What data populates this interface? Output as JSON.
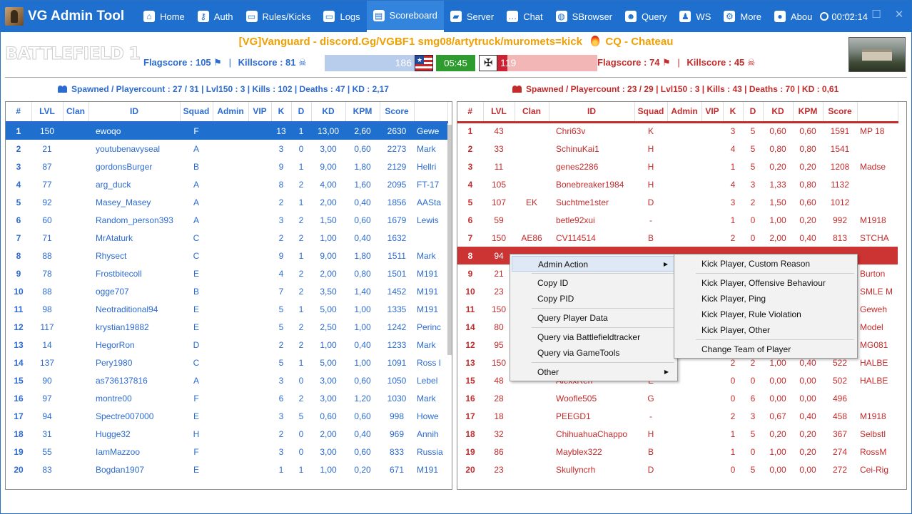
{
  "app": {
    "title": "VG Admin Tool"
  },
  "nav": [
    {
      "label": "Home",
      "icon": "home-icon",
      "glyph": "⌂"
    },
    {
      "label": "Auth",
      "icon": "key-icon",
      "glyph": "⚷"
    },
    {
      "label": "Rules/Kicks",
      "icon": "monitor-icon",
      "glyph": "▭"
    },
    {
      "label": "Logs",
      "icon": "monitor-icon",
      "glyph": "▭"
    },
    {
      "label": "Scoreboard",
      "icon": "scoreboard-icon",
      "glyph": "▤"
    },
    {
      "label": "Server",
      "icon": "folder-icon",
      "glyph": "▰"
    },
    {
      "label": "Chat",
      "icon": "chat-icon",
      "glyph": "…"
    },
    {
      "label": "SBrowser",
      "icon": "globe-icon",
      "glyph": "◍"
    },
    {
      "label": "Query",
      "icon": "user-icon",
      "glyph": "☻"
    },
    {
      "label": "WS",
      "icon": "penguin-icon",
      "glyph": "♟"
    },
    {
      "label": "More",
      "icon": "gear-icon",
      "glyph": "⚙"
    },
    {
      "label": "Abou",
      "icon": "pin-icon",
      "glyph": "●"
    }
  ],
  "active_tab": "Scoreboard",
  "timer": "00:02:14",
  "window_controls": {
    "minimize": "—",
    "maximize": "☐",
    "close": "✕"
  },
  "header": {
    "game_logo": "BATTLEFIELD 1",
    "server_name": "[VG]Vanguard - discord.Gg/VGBF1 smg08/artytruck/muromets=kick",
    "mode_map": "CQ - Chateau",
    "left_flagscore": "Flagscore : 105",
    "left_killscore": "Killscore : 81",
    "right_flagscore": "Flagscore : 74",
    "right_killscore": "Killscore : 45",
    "left_tickets": "186",
    "right_tickets": "119",
    "right_ticket_fill": 0.1,
    "round_time": "05:45",
    "colors": {
      "team1": "#2c6bd1",
      "team2": "#c42b2b",
      "accent": "#1e6fce",
      "timer_bg": "#2e9b2e",
      "title_orange": "#f2a000"
    }
  },
  "team1": {
    "stats": "Spawned / Playercount : 27 / 31  |  Lvl150 : 3  |  Kills : 102  |  Deaths : 47 | KD : 2,17",
    "columns": [
      "#",
      "LVL",
      "Clan",
      "ID",
      "Squad",
      "Admin",
      "VIP",
      "K",
      "D",
      "KD",
      "KPM",
      "Score",
      ""
    ],
    "rows": [
      [
        "1",
        "150",
        "",
        "ewoqo",
        "F",
        "",
        "",
        "13",
        "1",
        "13,00",
        "2,60",
        "2630",
        "Gewe"
      ],
      [
        "2",
        "21",
        "",
        "youtubenavyseal",
        "A",
        "",
        "",
        "3",
        "0",
        "3,00",
        "0,60",
        "2273",
        "Mark"
      ],
      [
        "3",
        "87",
        "",
        "gordonsBurger",
        "B",
        "",
        "",
        "9",
        "1",
        "9,00",
        "1,80",
        "2129",
        "Hellri"
      ],
      [
        "4",
        "77",
        "",
        "arg_duck",
        "A",
        "",
        "",
        "8",
        "2",
        "4,00",
        "1,60",
        "2095",
        "FT-17"
      ],
      [
        "5",
        "92",
        "",
        "Masey_Masey",
        "A",
        "",
        "",
        "2",
        "1",
        "2,00",
        "0,40",
        "1856",
        "AASta"
      ],
      [
        "6",
        "60",
        "",
        "Random_person393",
        "A",
        "",
        "",
        "3",
        "2",
        "1,50",
        "0,60",
        "1679",
        "Lewis"
      ],
      [
        "7",
        "71",
        "",
        "MrAtaturk",
        "C",
        "",
        "",
        "2",
        "2",
        "1,00",
        "0,40",
        "1632",
        ""
      ],
      [
        "8",
        "88",
        "",
        "Rhysect",
        "C",
        "",
        "",
        "9",
        "1",
        "9,00",
        "1,80",
        "1511",
        "Mark"
      ],
      [
        "9",
        "78",
        "",
        "Frostbitecoll",
        "E",
        "",
        "",
        "4",
        "2",
        "2,00",
        "0,80",
        "1501",
        "M191"
      ],
      [
        "10",
        "88",
        "",
        "ogge707",
        "B",
        "",
        "",
        "7",
        "2",
        "3,50",
        "1,40",
        "1452",
        "M191"
      ],
      [
        "11",
        "98",
        "",
        "Neotraditional94",
        "E",
        "",
        "",
        "5",
        "1",
        "5,00",
        "1,00",
        "1335",
        "M191"
      ],
      [
        "12",
        "117",
        "",
        "krystian19882",
        "E",
        "",
        "",
        "5",
        "2",
        "2,50",
        "1,00",
        "1242",
        "Perinc"
      ],
      [
        "13",
        "14",
        "",
        "HegorRon",
        "D",
        "",
        "",
        "2",
        "2",
        "1,00",
        "0,40",
        "1233",
        "Mark"
      ],
      [
        "14",
        "137",
        "",
        "Pery1980",
        "C",
        "",
        "",
        "5",
        "1",
        "5,00",
        "1,00",
        "1091",
        "Ross I"
      ],
      [
        "15",
        "90",
        "",
        "as736137816",
        "A",
        "",
        "",
        "3",
        "0",
        "3,00",
        "0,60",
        "1050",
        "Lebel"
      ],
      [
        "16",
        "97",
        "",
        "montre00",
        "F",
        "",
        "",
        "6",
        "2",
        "3,00",
        "1,20",
        "1030",
        "Mark"
      ],
      [
        "17",
        "94",
        "",
        "Spectre007000",
        "E",
        "",
        "",
        "3",
        "5",
        "0,60",
        "0,60",
        "998",
        "Howe"
      ],
      [
        "18",
        "31",
        "",
        "Hugge32",
        "H",
        "",
        "",
        "2",
        "0",
        "2,00",
        "0,40",
        "969",
        "Annih"
      ],
      [
        "19",
        "55",
        "",
        "IamMazzoo",
        "F",
        "",
        "",
        "3",
        "0",
        "3,00",
        "0,60",
        "833",
        "Russia"
      ],
      [
        "20",
        "83",
        "",
        "Bogdan1907",
        "E",
        "",
        "",
        "1",
        "1",
        "1,00",
        "0,20",
        "671",
        "M191"
      ]
    ]
  },
  "team2": {
    "stats": "Spawned / Playercount : 23 / 29  |  Lvl150 : 3  |  Kills : 43  |  Deaths : 70 | KD : 0,61",
    "columns": [
      "#",
      "LVL",
      "Clan",
      "ID",
      "Squad",
      "Admin",
      "VIP",
      "K",
      "D",
      "KD",
      "KPM",
      "Score",
      ""
    ],
    "rows": [
      [
        "1",
        "43",
        "",
        "Chri63v",
        "K",
        "",
        "",
        "3",
        "5",
        "0,60",
        "0,60",
        "1591",
        "MP 18"
      ],
      [
        "2",
        "33",
        "",
        "SchinuKai1",
        "H",
        "",
        "",
        "4",
        "5",
        "0,80",
        "0,80",
        "1541",
        ""
      ],
      [
        "3",
        "11",
        "",
        "genes2286",
        "H",
        "",
        "",
        "1",
        "5",
        "0,20",
        "0,20",
        "1208",
        "Madse"
      ],
      [
        "4",
        "105",
        "",
        "Bonebreaker1984",
        "H",
        "",
        "",
        "4",
        "3",
        "1,33",
        "0,80",
        "1132",
        ""
      ],
      [
        "5",
        "107",
        "EK",
        "Suchtme1ster",
        "D",
        "",
        "",
        "3",
        "2",
        "1,50",
        "0,60",
        "1012",
        ""
      ],
      [
        "6",
        "59",
        "",
        "betle92xui",
        "-",
        "",
        "",
        "1",
        "0",
        "1,00",
        "0,20",
        "992",
        "M1918"
      ],
      [
        "7",
        "150",
        "AE86",
        "CV114514",
        "B",
        "",
        "",
        "2",
        "0",
        "2,00",
        "0,40",
        "813",
        "STCHA"
      ],
      [
        "8",
        "94",
        "",
        "",
        "",
        "",
        "",
        "",
        "",
        "",
        "",
        "",
        ""
      ],
      [
        "9",
        "21",
        "",
        "",
        "",
        "",
        "",
        "",
        "",
        "",
        "",
        "",
        "Burton"
      ],
      [
        "10",
        "23",
        "",
        "",
        "",
        "",
        "",
        "",
        "",
        "",
        "",
        "",
        "SMLE M"
      ],
      [
        "11",
        "150",
        "",
        "",
        "",
        "",
        "",
        "",
        "",
        "",
        "",
        "",
        "Geweh"
      ],
      [
        "14",
        "80",
        "",
        "",
        "",
        "",
        "",
        "",
        "",
        "",
        "",
        "",
        "Model"
      ],
      [
        "12",
        "95",
        "",
        "",
        "",
        "",
        "",
        "",
        "",
        "",
        "",
        "",
        "MG081"
      ],
      [
        "13",
        "150",
        "",
        "",
        "",
        "",
        "",
        "2",
        "2",
        "1,00",
        "0,40",
        "522",
        "HALBE"
      ],
      [
        "15",
        "48",
        "",
        "AlexxRen",
        "E",
        "",
        "",
        "0",
        "0",
        "0,00",
        "0,00",
        "502",
        "HALBE"
      ],
      [
        "16",
        "28",
        "",
        "Woofle505",
        "G",
        "",
        "",
        "0",
        "6",
        "0,00",
        "0,00",
        "496",
        ""
      ],
      [
        "17",
        "18",
        "",
        "PEEGD1",
        "-",
        "",
        "",
        "2",
        "3",
        "0,67",
        "0,40",
        "458",
        "M1918"
      ],
      [
        "18",
        "32",
        "",
        "ChihuahuaChappo",
        "H",
        "",
        "",
        "1",
        "5",
        "0,20",
        "0,20",
        "367",
        "Selbstl"
      ],
      [
        "19",
        "86",
        "",
        "Mayblex322",
        "B",
        "",
        "",
        "1",
        "0",
        "1,00",
        "0,20",
        "274",
        "RossM"
      ],
      [
        "20",
        "23",
        "",
        "Skullyncrh",
        "D",
        "",
        "",
        "0",
        "5",
        "0,00",
        "0,00",
        "272",
        "Cei-Rig"
      ]
    ]
  },
  "context_menu": {
    "items": [
      "Admin Action",
      "Copy ID",
      "Copy PID",
      "Query Player Data",
      "Query via Battlefieldtracker",
      "Query via GameTools",
      "Other"
    ],
    "submenu": [
      "Kick Player, Custom Reason",
      "Kick Player, Offensive Behaviour",
      "Kick Player, Ping",
      "Kick Player, Rule Violation",
      "Kick Player, Other",
      "Change Team of Player"
    ]
  }
}
